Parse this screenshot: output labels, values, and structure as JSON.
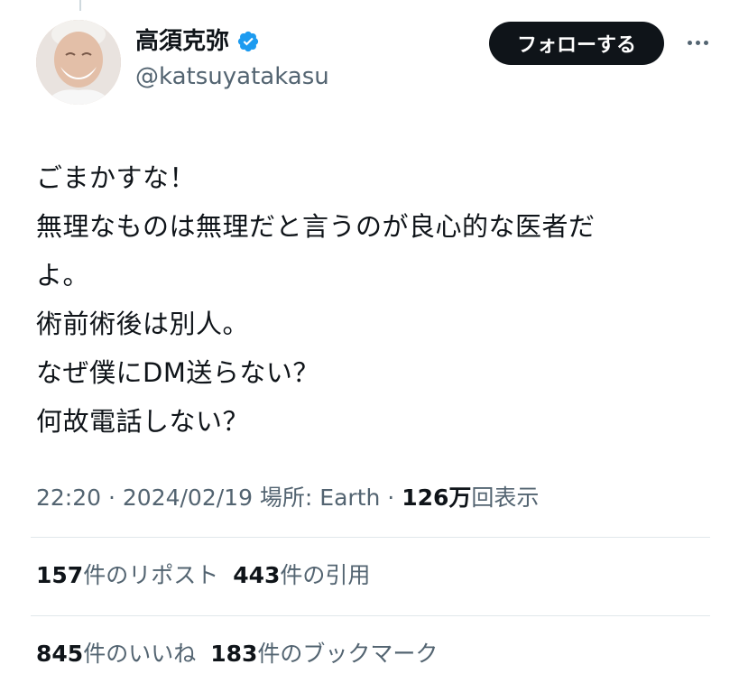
{
  "user": {
    "display_name": "高須克弥",
    "handle": "@katsuyatakasu",
    "verified": true,
    "avatar_icon": "avatar-photo"
  },
  "actions": {
    "follow_label": "フォローする",
    "more_icon": "more-dots-icon"
  },
  "tweet": {
    "lines": [
      "ごまかすな！",
      "無理なものは無理だと言うのが良心的な医者だ",
      "よ。",
      "術前術後は別人。",
      "なぜ僕にDM送らない？",
      "何故電話しない？"
    ]
  },
  "meta": {
    "time": "22:20",
    "separator1": " · ",
    "date": "2024/02/19",
    "location": " 場所: Earth",
    "separator2": " · ",
    "views_count": "126万",
    "views_label": "回表示"
  },
  "stats_row1": [
    {
      "count": "157",
      "label": "件のリポスト"
    },
    {
      "count": "443",
      "label": "件の引用"
    }
  ],
  "stats_row2": [
    {
      "count": "845",
      "label": "件のいいね"
    },
    {
      "count": "183",
      "label": "件のブックマーク"
    }
  ],
  "colors": {
    "text": "#0f1419",
    "secondary": "#536471",
    "verified": "#1d9bf0",
    "divider": "#e1e7eb"
  }
}
